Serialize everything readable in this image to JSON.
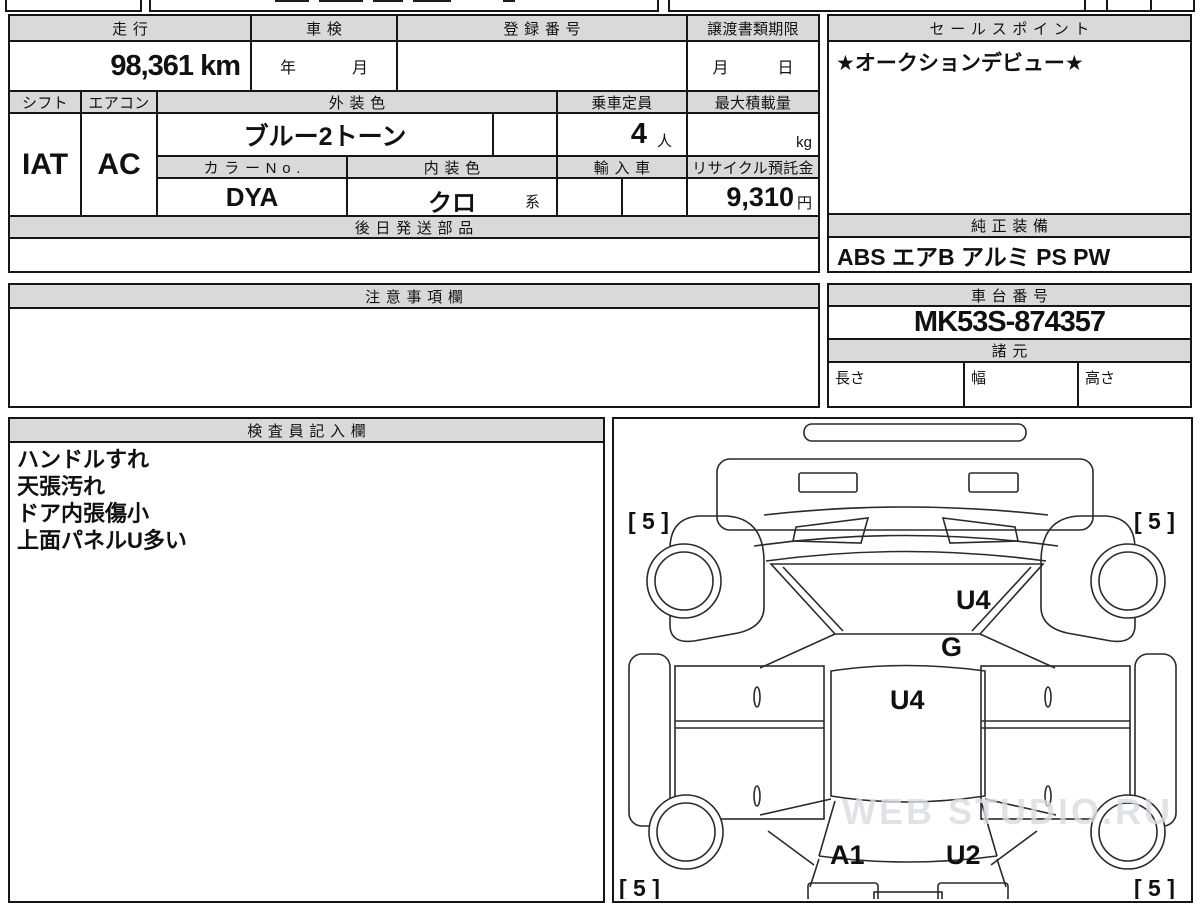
{
  "labels": {
    "mileage": "走行",
    "inspection": "車検",
    "registration_no": "登録番号",
    "transfer_deadline": "譲渡書類期限",
    "shift": "シフト",
    "aircon": "エアコン",
    "exterior_color": "外装色",
    "capacity": "乗車定員",
    "max_load": "最大積載量",
    "color_no": "カラーNo.",
    "interior_color": "内装色",
    "import_car": "輸入車",
    "recycle_deposit": "リサイクル預託金",
    "later_shipped_parts": "後日発送部品",
    "sales_point": "セールスポイント",
    "genuine_equipment": "純正装備",
    "notes": "注意事項欄",
    "chassis_no": "車台番号",
    "specs": "諸元",
    "spec_length": "長さ",
    "spec_width": "幅",
    "spec_height": "高さ",
    "inspector_column": "検査員記入欄",
    "inspection_year": "年",
    "inspection_month": "月",
    "transfer_month": "月",
    "transfer_day": "日"
  },
  "vehicle": {
    "mileage": "98,361 km",
    "shift": "IAT",
    "aircon": "AC",
    "exterior_color": "ブルー2トーン",
    "capacity": "4",
    "capacity_unit": "人",
    "max_load_unit": "kg",
    "color_no": "DYA",
    "interior_color": "クロ",
    "interior_color_suffix": "系",
    "recycle_deposit": "9,310",
    "recycle_deposit_unit": "円",
    "chassis_no": "MK53S-874357",
    "sales_point": "★オークションデビュー★",
    "equipment": "ABS エアB アルミ PS PW"
  },
  "inspector_notes": {
    "line1": "ハンドルすれ",
    "line2": "天張汚れ",
    "line3": "ドア内張傷小",
    "line4": "上面パネルU多い"
  },
  "diagram": {
    "marks": {
      "tire_front_left": "[ 5 ]",
      "tire_front_right": "[ 5 ]",
      "tire_rear_left": "[ 5 ]",
      "tire_rear_right": "[ 5 ]",
      "windshield": "U4",
      "right_pillar": "G",
      "roof": "U4",
      "rear_gate_left": "A1",
      "rear_gate_right": "U2"
    },
    "watermark": "WEB STUDIO.RU"
  }
}
